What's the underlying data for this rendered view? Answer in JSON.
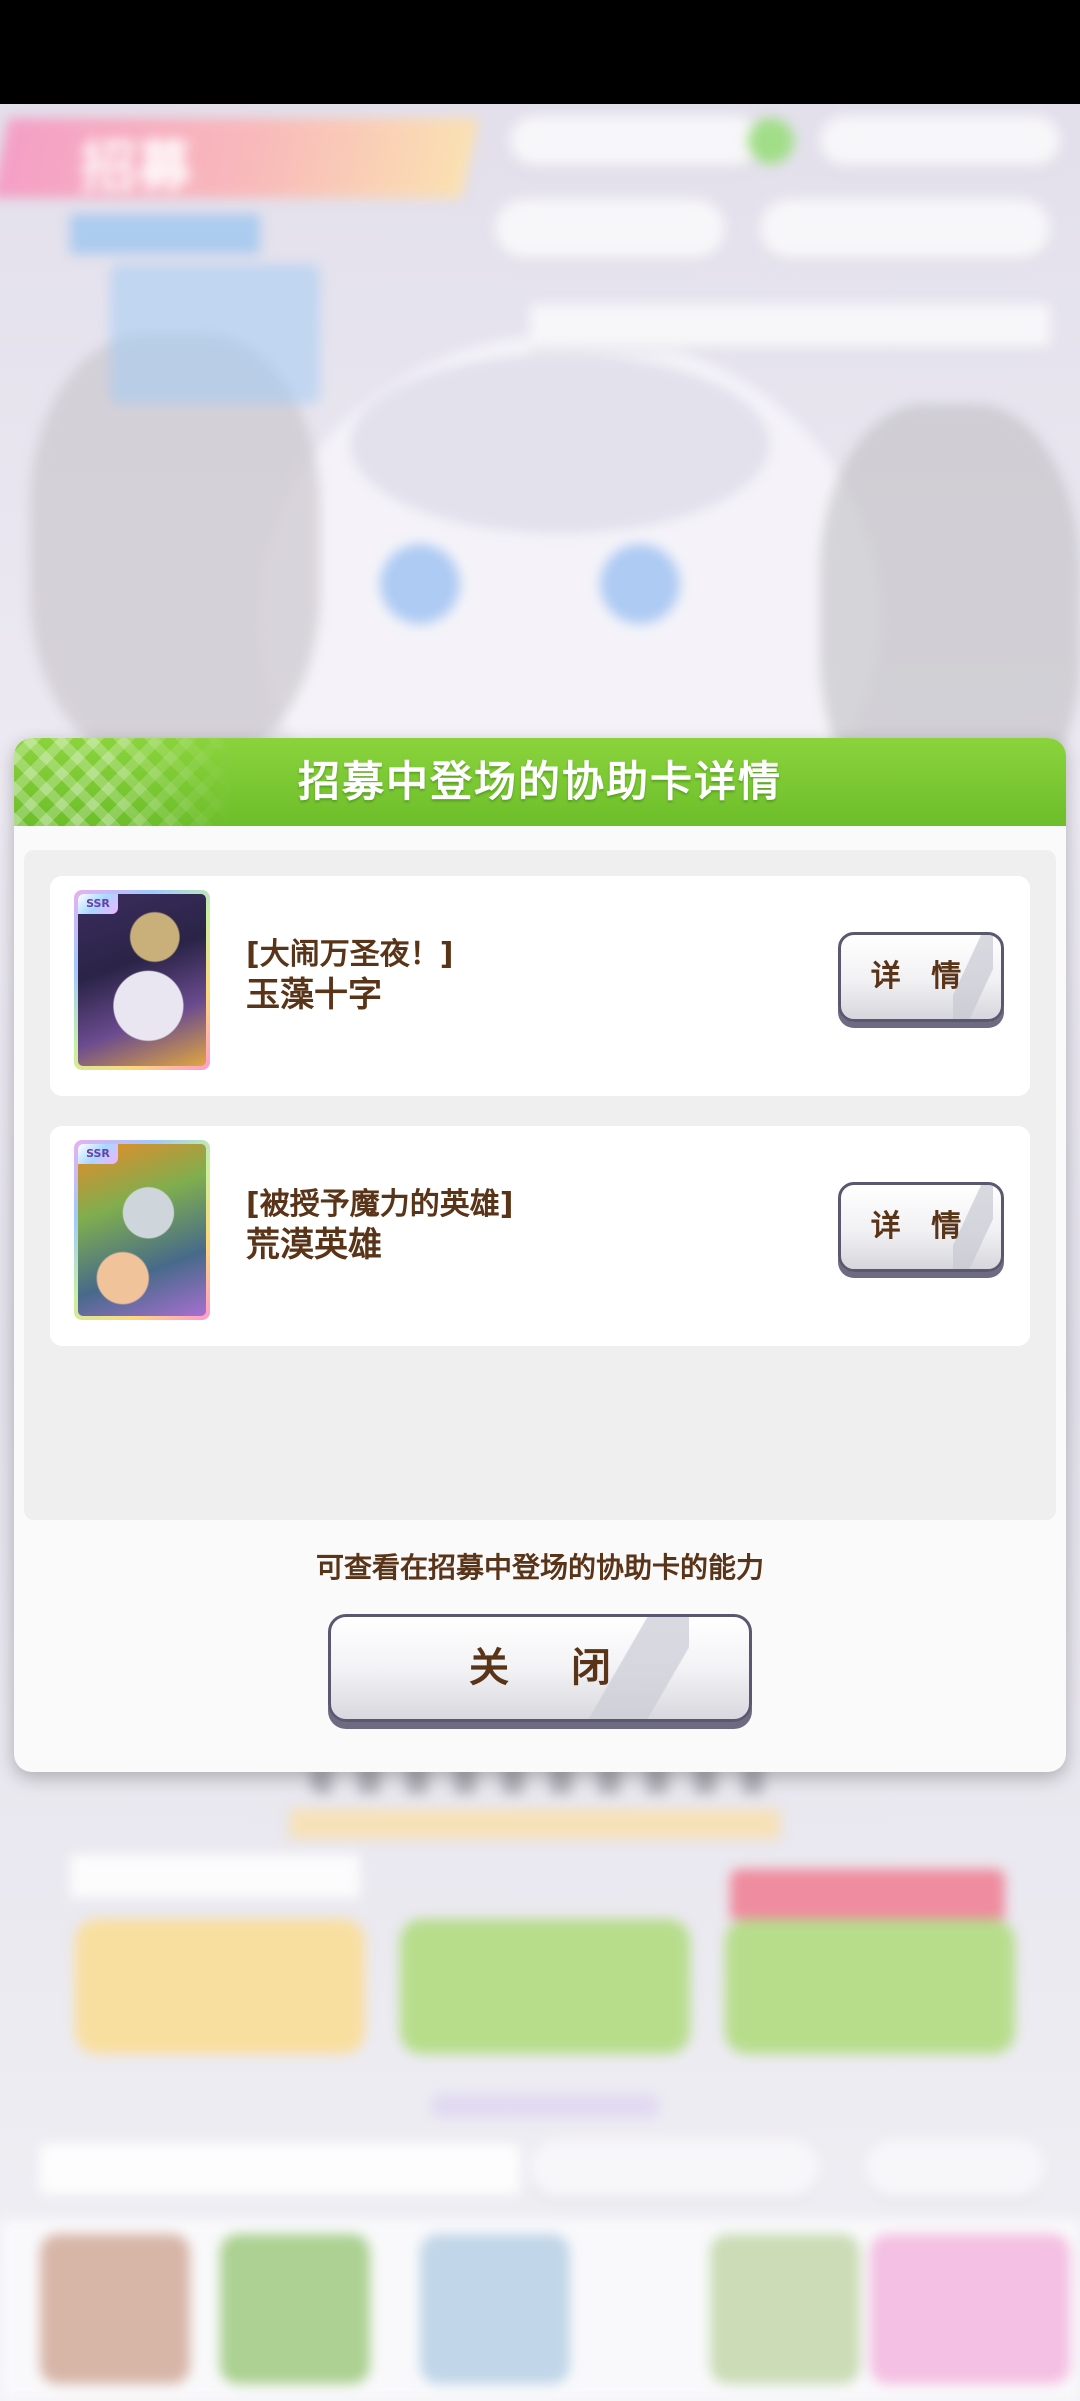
{
  "dialog": {
    "title": "招募中登场的协助卡详情",
    "description": "可查看在招募中登场的协助卡的能力",
    "close_label": "关 闭"
  },
  "cards": [
    {
      "rarity": "SSR",
      "epithet": "[大闹万圣夜！]",
      "name": "玉藻十字",
      "detail_label": "详 情"
    },
    {
      "rarity": "SSR",
      "epithet": "[被授予魔力的英雄]",
      "name": "荒漠英雄",
      "detail_label": "详 情"
    }
  ],
  "background": {
    "screen_title": "招募"
  },
  "colors": {
    "header_green": "#7cc834",
    "text_brown": "#5a3418",
    "button_border": "#5a5870"
  }
}
